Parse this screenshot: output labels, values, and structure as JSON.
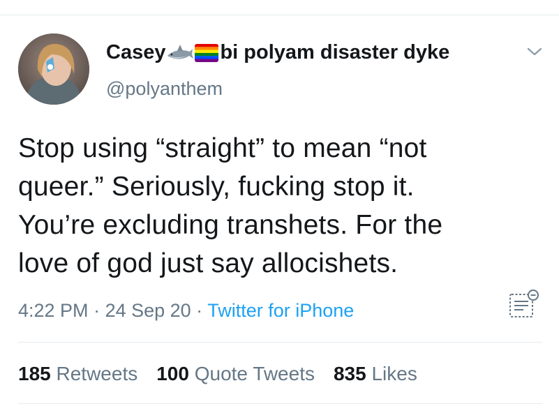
{
  "tweet": {
    "display_name_start": "Casey",
    "display_name_end": "bi polyam disaster dyke",
    "name_emoji": [
      "shark-icon",
      "rainbow-flag-icon"
    ],
    "handle": "@polyanthem",
    "text": "Stop using “straight” to mean “not\nqueer.” Seriously, fucking stop it.\nYou’re excluding transhets. For the\nlove of god just say allocishets.",
    "time": "4:22 PM",
    "date": "24 Sep 20",
    "separator": " · ",
    "source": "Twitter for iPhone"
  },
  "stats": {
    "retweets_count": "185",
    "retweets_label": "Retweets",
    "quotes_count": "100",
    "quotes_label": "Quote Tweets",
    "likes_count": "835",
    "likes_label": "Likes"
  },
  "colors": {
    "text": "#14171a",
    "secondary": "#657786",
    "link": "#1da1f2",
    "divider": "#e6ecf0"
  }
}
